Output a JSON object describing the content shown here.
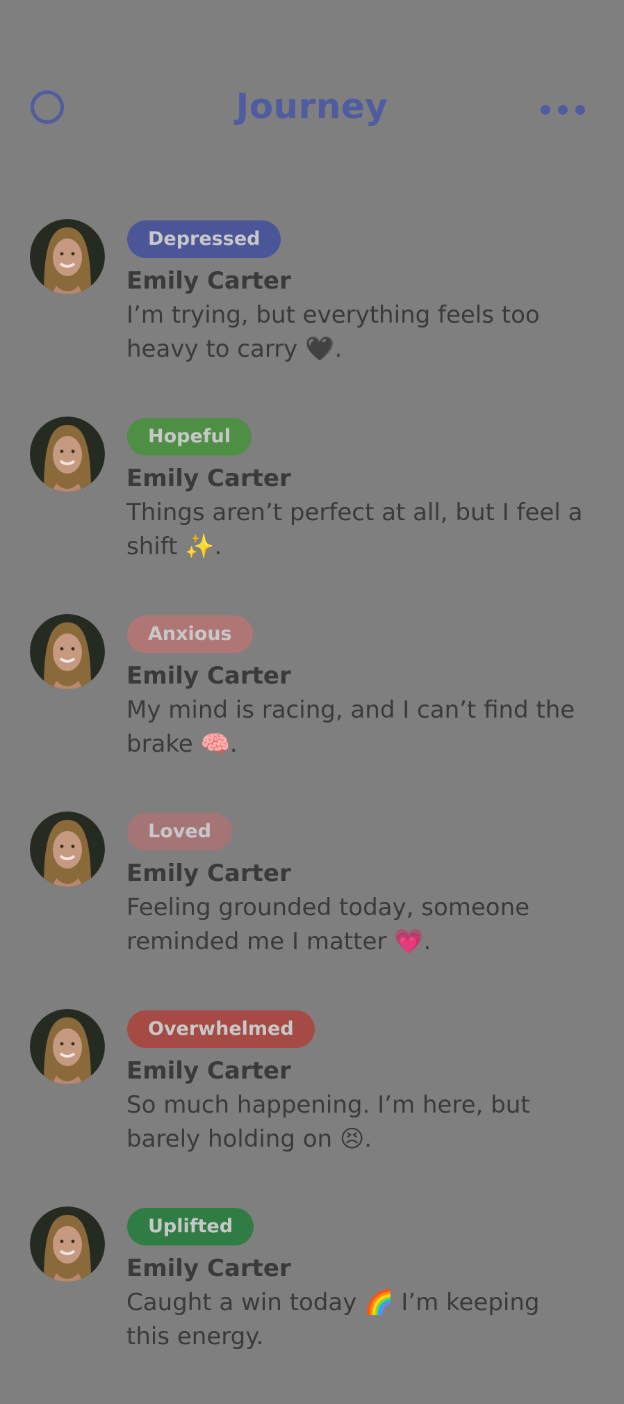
{
  "header": {
    "title": "Journey"
  },
  "colors": {
    "background": "#7f7f7f",
    "accent": "#4f5c9f",
    "text": "#3a3a3a"
  },
  "entries": [
    {
      "mood": "Depressed",
      "mood_color": "#4a5697",
      "author": "Emily Carter",
      "text": "I’m trying, but everything feels too heavy to carry 🖤."
    },
    {
      "mood": "Hopeful",
      "mood_color": "#4f8f45",
      "author": "Emily Carter",
      "text": "Things aren’t perfect at all, but I feel a shift ✨."
    },
    {
      "mood": "Anxious",
      "mood_color": "#b07575",
      "author": "Emily Carter",
      "text": "My mind is racing, and I can’t find the brake 🧠."
    },
    {
      "mood": "Loved",
      "mood_color": "#a57474",
      "author": "Emily Carter",
      "text": "Feeling grounded today, someone reminded me I matter 💗."
    },
    {
      "mood": "Overwhelmed",
      "mood_color": "#a54a45",
      "author": "Emily Carter",
      "text": "So much happening. I’m here, but barely holding on 😣."
    },
    {
      "mood": "Uplifted",
      "mood_color": "#2f7d44",
      "author": "Emily Carter",
      "text": "Caught a win today 🌈 I’m keeping this energy."
    }
  ]
}
